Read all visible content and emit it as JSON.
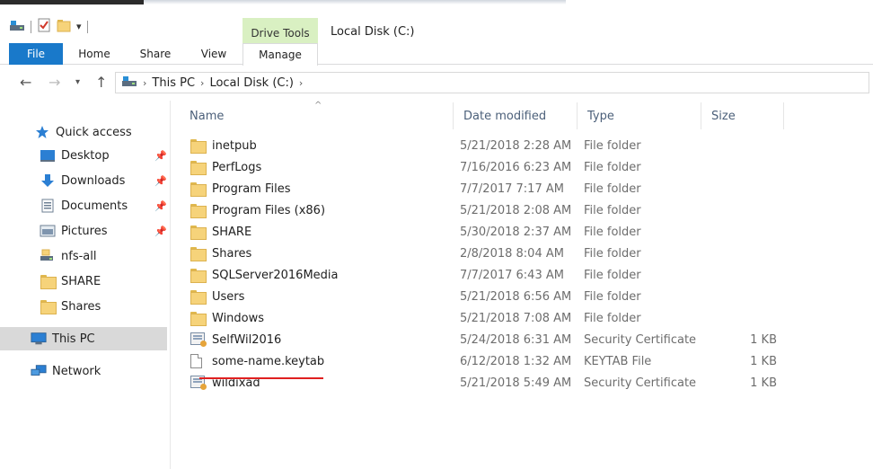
{
  "window": {
    "title": "Local Disk (C:)",
    "context_tab_group": "Drive Tools"
  },
  "ribbon": {
    "tabs": [
      {
        "label": "File"
      },
      {
        "label": "Home"
      },
      {
        "label": "Share"
      },
      {
        "label": "View"
      },
      {
        "label": "Manage"
      }
    ]
  },
  "address": {
    "crumbs": [
      "This PC",
      "Local Disk (C:)"
    ]
  },
  "nav": {
    "quick_access": "Quick access",
    "items": [
      {
        "label": "Desktop",
        "icon": "desktop-icon",
        "pinned": true
      },
      {
        "label": "Downloads",
        "icon": "download-arrow-icon",
        "pinned": true
      },
      {
        "label": "Documents",
        "icon": "documents-icon",
        "pinned": true
      },
      {
        "label": "Pictures",
        "icon": "pictures-icon",
        "pinned": true
      },
      {
        "label": "nfs-all",
        "icon": "network-drive-icon",
        "pinned": false
      },
      {
        "label": "SHARE",
        "icon": "folder-icon",
        "pinned": false
      },
      {
        "label": "Shares",
        "icon": "folder-icon",
        "pinned": false
      }
    ],
    "this_pc": "This PC",
    "network": "Network"
  },
  "columns": {
    "name": "Name",
    "date": "Date modified",
    "type": "Type",
    "size": "Size"
  },
  "files": [
    {
      "name": "inetpub",
      "date": "5/21/2018 2:28 AM",
      "type": "File folder",
      "size": "",
      "icon": "folder"
    },
    {
      "name": "PerfLogs",
      "date": "7/16/2016 6:23 AM",
      "type": "File folder",
      "size": "",
      "icon": "folder"
    },
    {
      "name": "Program Files",
      "date": "7/7/2017 7:17 AM",
      "type": "File folder",
      "size": "",
      "icon": "folder"
    },
    {
      "name": "Program Files (x86)",
      "date": "5/21/2018 2:08 AM",
      "type": "File folder",
      "size": "",
      "icon": "folder"
    },
    {
      "name": "SHARE",
      "date": "5/30/2018 2:37 AM",
      "type": "File folder",
      "size": "",
      "icon": "folder"
    },
    {
      "name": "Shares",
      "date": "2/8/2018 8:04 AM",
      "type": "File folder",
      "size": "",
      "icon": "folder"
    },
    {
      "name": "SQLServer2016Media",
      "date": "7/7/2017 6:43 AM",
      "type": "File folder",
      "size": "",
      "icon": "folder"
    },
    {
      "name": "Users",
      "date": "5/21/2018 6:56 AM",
      "type": "File folder",
      "size": "",
      "icon": "folder"
    },
    {
      "name": "Windows",
      "date": "5/21/2018 7:08 AM",
      "type": "File folder",
      "size": "",
      "icon": "folder"
    },
    {
      "name": "SelfWil2016",
      "date": "5/24/2018 6:31 AM",
      "type": "Security Certificate",
      "size": "1 KB",
      "icon": "certificate"
    },
    {
      "name": "some-name.keytab",
      "date": "6/12/2018 1:32 AM",
      "type": "KEYTAB File",
      "size": "1 KB",
      "icon": "file"
    },
    {
      "name": "wildixad",
      "date": "5/21/2018 5:49 AM",
      "type": "Security Certificate",
      "size": "1 KB",
      "icon": "certificate"
    }
  ],
  "colors": {
    "file_tab": "#1979ca",
    "drive_tools": "#d9f0c2",
    "highlight_underline": "#e02020",
    "selected_nav": "#d9d9d9"
  }
}
